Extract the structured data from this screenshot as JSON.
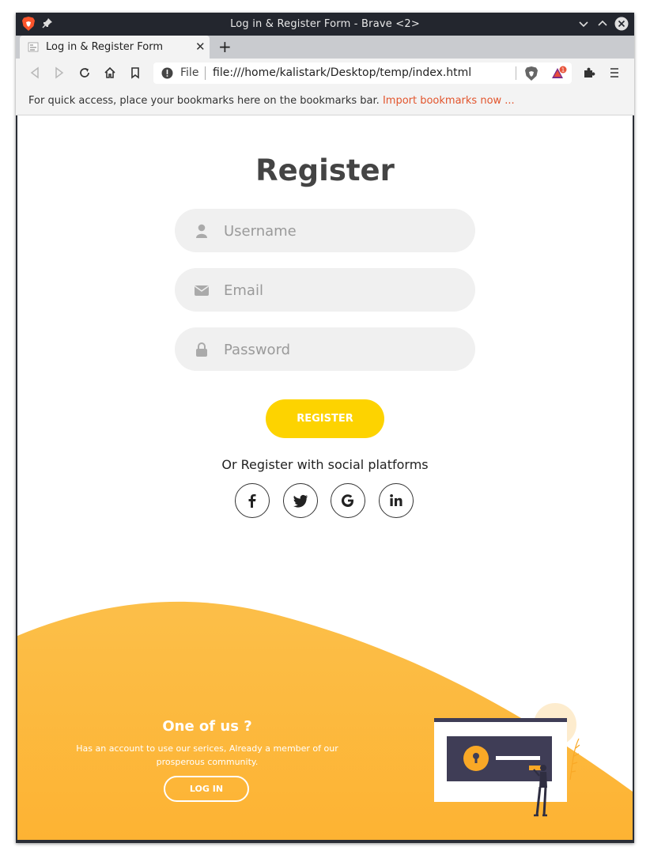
{
  "window": {
    "title": "Log in & Register Form - Brave <2>"
  },
  "tab": {
    "label": "Log in & Register Form",
    "close": "✕",
    "new": "+"
  },
  "omnibox": {
    "scheme": "File",
    "url": "file:///home/kalistark/Desktop/temp/index.html",
    "rewards_badge": "1"
  },
  "bookmarks": {
    "message": "For quick access, place your bookmarks here on the bookmarks bar.",
    "import_link": "Import bookmarks now ..."
  },
  "register": {
    "title": "Register",
    "username_placeholder": "Username",
    "email_placeholder": "Email",
    "password_placeholder": "Password",
    "button": "REGISTER",
    "social_text": "Or Register with social platforms",
    "social": [
      "facebook-icon",
      "twitter-icon",
      "google-icon",
      "linkedin-icon"
    ]
  },
  "panel": {
    "title": "One of us ?",
    "text": "Has an account to use our serices, Already a member of our prosperous community.",
    "button": "LOG IN"
  },
  "colors": {
    "accent_yellow": "#fdd300",
    "panel_orange": "#fbb43f",
    "link_orange": "#e2552d"
  }
}
